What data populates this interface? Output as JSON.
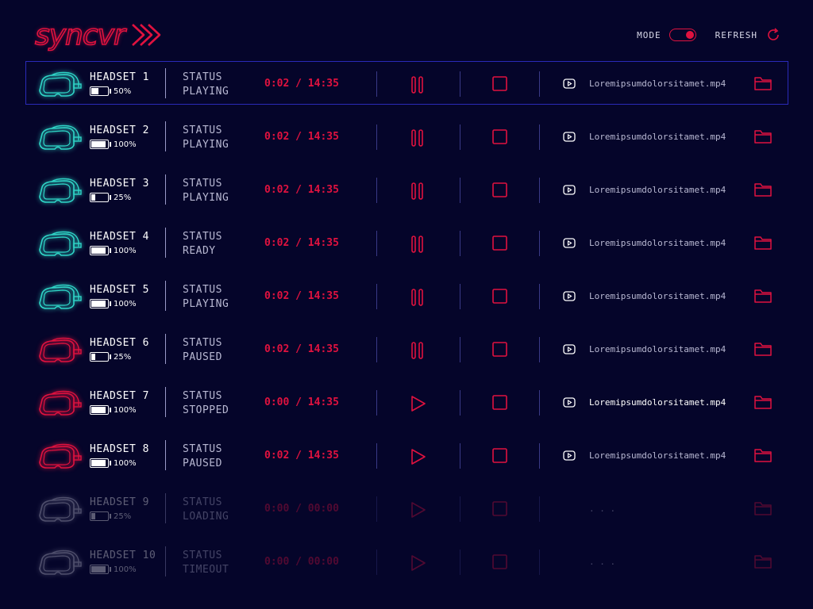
{
  "header": {
    "logo_text": "syncvr",
    "mode_label": "MODE",
    "mode_on": true,
    "refresh_label": "REFRESH"
  },
  "colors": {
    "bg": "#05052a",
    "accent": "#e0123f",
    "ready": "#2fd6c8",
    "offline": "#d8d8e8",
    "select": "#2a2ab8"
  },
  "status_label": "STATUS",
  "headsets": [
    {
      "name": "HEADSET 1",
      "battery": "50%",
      "battery_level": 0.5,
      "status": "PLAYING",
      "time": "0:02 / 14:35",
      "control": "pause",
      "file": "Loremipsumdolorsitamet.mp4",
      "color": "#2fd6c8",
      "selected": true,
      "dim": false
    },
    {
      "name": "HEADSET 2",
      "battery": "100%",
      "battery_level": 1.0,
      "status": "PLAYING",
      "time": "0:02 / 14:35",
      "control": "pause",
      "file": "Loremipsumdolorsitamet.mp4",
      "color": "#2fd6c8",
      "selected": false,
      "dim": false
    },
    {
      "name": "HEADSET 3",
      "battery": "25%",
      "battery_level": 0.25,
      "status": "PLAYING",
      "time": "0:02 / 14:35",
      "control": "pause",
      "file": "Loremipsumdolorsitamet.mp4",
      "color": "#2fd6c8",
      "selected": false,
      "dim": false
    },
    {
      "name": "HEADSET 4",
      "battery": "100%",
      "battery_level": 1.0,
      "status": "READY",
      "time": "0:02 / 14:35",
      "control": "pause",
      "file": "Loremipsumdolorsitamet.mp4",
      "color": "#2fd6c8",
      "selected": false,
      "dim": false
    },
    {
      "name": "HEADSET 5",
      "battery": "100%",
      "battery_level": 1.0,
      "status": "PLAYING",
      "time": "0:02 / 14:35",
      "control": "pause",
      "file": "Loremipsumdolorsitamet.mp4",
      "color": "#2fd6c8",
      "selected": false,
      "dim": false
    },
    {
      "name": "HEADSET 6",
      "battery": "25%",
      "battery_level": 0.25,
      "status": "PAUSED",
      "time": "0:02 / 14:35",
      "control": "pause",
      "file": "Loremipsumdolorsitamet.mp4",
      "color": "#e0123f",
      "selected": false,
      "dim": false
    },
    {
      "name": "HEADSET 7",
      "battery": "100%",
      "battery_level": 1.0,
      "status": "STOPPED",
      "time": "0:00 / 14:35",
      "control": "play",
      "file": "Loremipsumdolorsitamet.mp4",
      "color": "#e0123f",
      "selected": false,
      "dim": false,
      "bright": true
    },
    {
      "name": "HEADSET 8",
      "battery": "100%",
      "battery_level": 1.0,
      "status": "PAUSED",
      "time": "0:02 / 14:35",
      "control": "play",
      "file": "Loremipsumdolorsitamet.mp4",
      "color": "#e0123f",
      "selected": false,
      "dim": false
    },
    {
      "name": "HEADSET 9",
      "battery": "25%",
      "battery_level": 0.25,
      "status": "LOADING",
      "time": "0:00 / 00:00",
      "control": "play",
      "file": ". . .",
      "color": "#d8d8e8",
      "selected": false,
      "dim": true,
      "no_video": true
    },
    {
      "name": "HEADSET 10",
      "battery": "100%",
      "battery_level": 1.0,
      "status": "TIMEOUT",
      "time": "0:00 / 00:00",
      "control": "play",
      "file": ". . .",
      "color": "#d8d8e8",
      "selected": false,
      "dim": true,
      "no_video": true
    }
  ]
}
